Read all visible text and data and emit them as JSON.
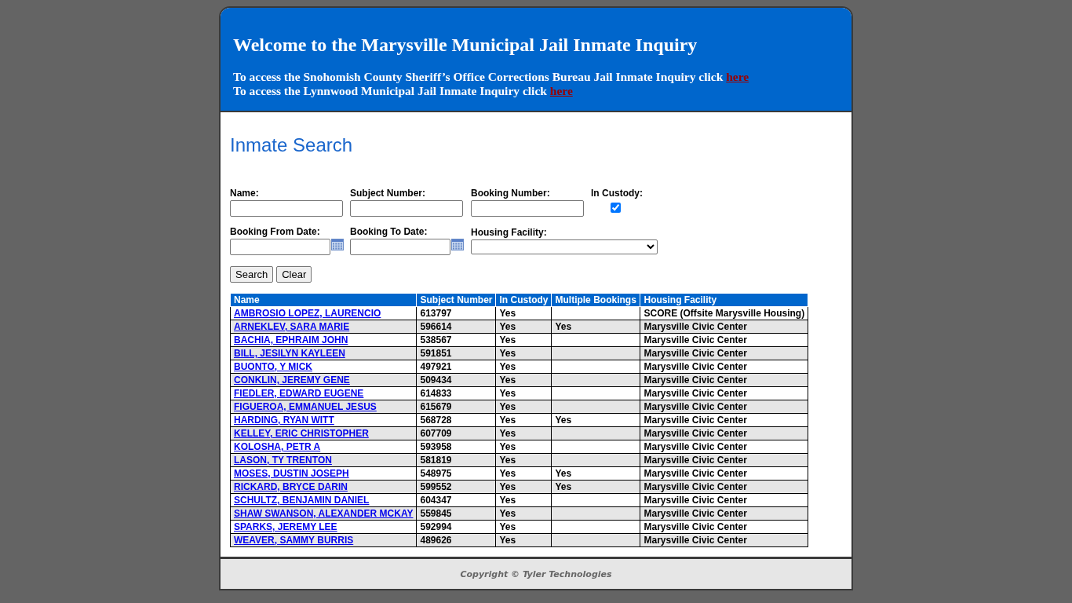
{
  "header": {
    "title": "Welcome to the Marysville Municipal Jail Inmate Inquiry",
    "lines": [
      {
        "text": "To access the Snohomish County Sheriff’s Office Corrections Bureau Jail Inmate Inquiry click",
        "link": "here"
      },
      {
        "text": "To access the Lynnwood Municipal Jail Inmate Inquiry click",
        "link": "here"
      }
    ]
  },
  "search": {
    "title": "Inmate Search",
    "fields": [
      {
        "kind": "text",
        "label": "Name:"
      },
      {
        "kind": "text",
        "label": "Subject Number:"
      },
      {
        "kind": "text",
        "label": "Booking Number:"
      },
      {
        "kind": "checkbox",
        "label": "In Custody:",
        "checked": true
      },
      {
        "kind": "date",
        "label": "Booking From Date:"
      },
      {
        "kind": "date",
        "label": "Booking To Date:"
      },
      {
        "kind": "select",
        "label": "Housing Facility:"
      }
    ],
    "buttons": [
      "Search",
      "Clear"
    ]
  },
  "table": {
    "columns": [
      "Name",
      "Subject Number",
      "In Custody",
      "Multiple Bookings",
      "Housing Facility"
    ],
    "rows": [
      [
        "AMBROSIO LOPEZ, LAURENCIO",
        "613797",
        "Yes",
        "",
        "SCORE (Offsite Marysville Housing)"
      ],
      [
        "ARNEKLEV, SARA MARIE",
        "596614",
        "Yes",
        "Yes",
        "Marysville Civic Center"
      ],
      [
        "BACHIA, EPHRAIM JOHN",
        "538567",
        "Yes",
        "",
        "Marysville Civic Center"
      ],
      [
        "BILL, JESILYN KAYLEEN",
        "591851",
        "Yes",
        "",
        "Marysville Civic Center"
      ],
      [
        "BUONTO, Y MICK",
        "497921",
        "Yes",
        "",
        "Marysville Civic Center"
      ],
      [
        "CONKLIN, JEREMY GENE",
        "509434",
        "Yes",
        "",
        "Marysville Civic Center"
      ],
      [
        "FIEDLER, EDWARD EUGENE",
        "614833",
        "Yes",
        "",
        "Marysville Civic Center"
      ],
      [
        "FIGUEROA, EMMANUEL JESUS",
        "615679",
        "Yes",
        "",
        "Marysville Civic Center"
      ],
      [
        "HARDING, RYAN WITT",
        "568728",
        "Yes",
        "Yes",
        "Marysville Civic Center"
      ],
      [
        "KELLEY, ERIC CHRISTOPHER",
        "607709",
        "Yes",
        "",
        "Marysville Civic Center"
      ],
      [
        "KOLOSHA, PETR A",
        "593958",
        "Yes",
        "",
        "Marysville Civic Center"
      ],
      [
        "LASON, TY TRENTON",
        "581819",
        "Yes",
        "",
        "Marysville Civic Center"
      ],
      [
        "MOSES, DUSTIN JOSEPH",
        "548975",
        "Yes",
        "Yes",
        "Marysville Civic Center"
      ],
      [
        "RICKARD, BRYCE DARIN",
        "599552",
        "Yes",
        "Yes",
        "Marysville Civic Center"
      ],
      [
        "SCHULTZ, BENJAMIN DANIEL",
        "604347",
        "Yes",
        "",
        "Marysville Civic Center"
      ],
      [
        "SHAW SWANSON, ALEXANDER MCKAY",
        "559845",
        "Yes",
        "",
        "Marysville Civic Center"
      ],
      [
        "SPARKS, JEREMY LEE",
        "592994",
        "Yes",
        "",
        "Marysville Civic Center"
      ],
      [
        "WEAVER, SAMMY BURRIS",
        "489626",
        "Yes",
        "",
        "Marysville Civic Center"
      ]
    ]
  },
  "footer": "Copyright © Tyler Technologies"
}
